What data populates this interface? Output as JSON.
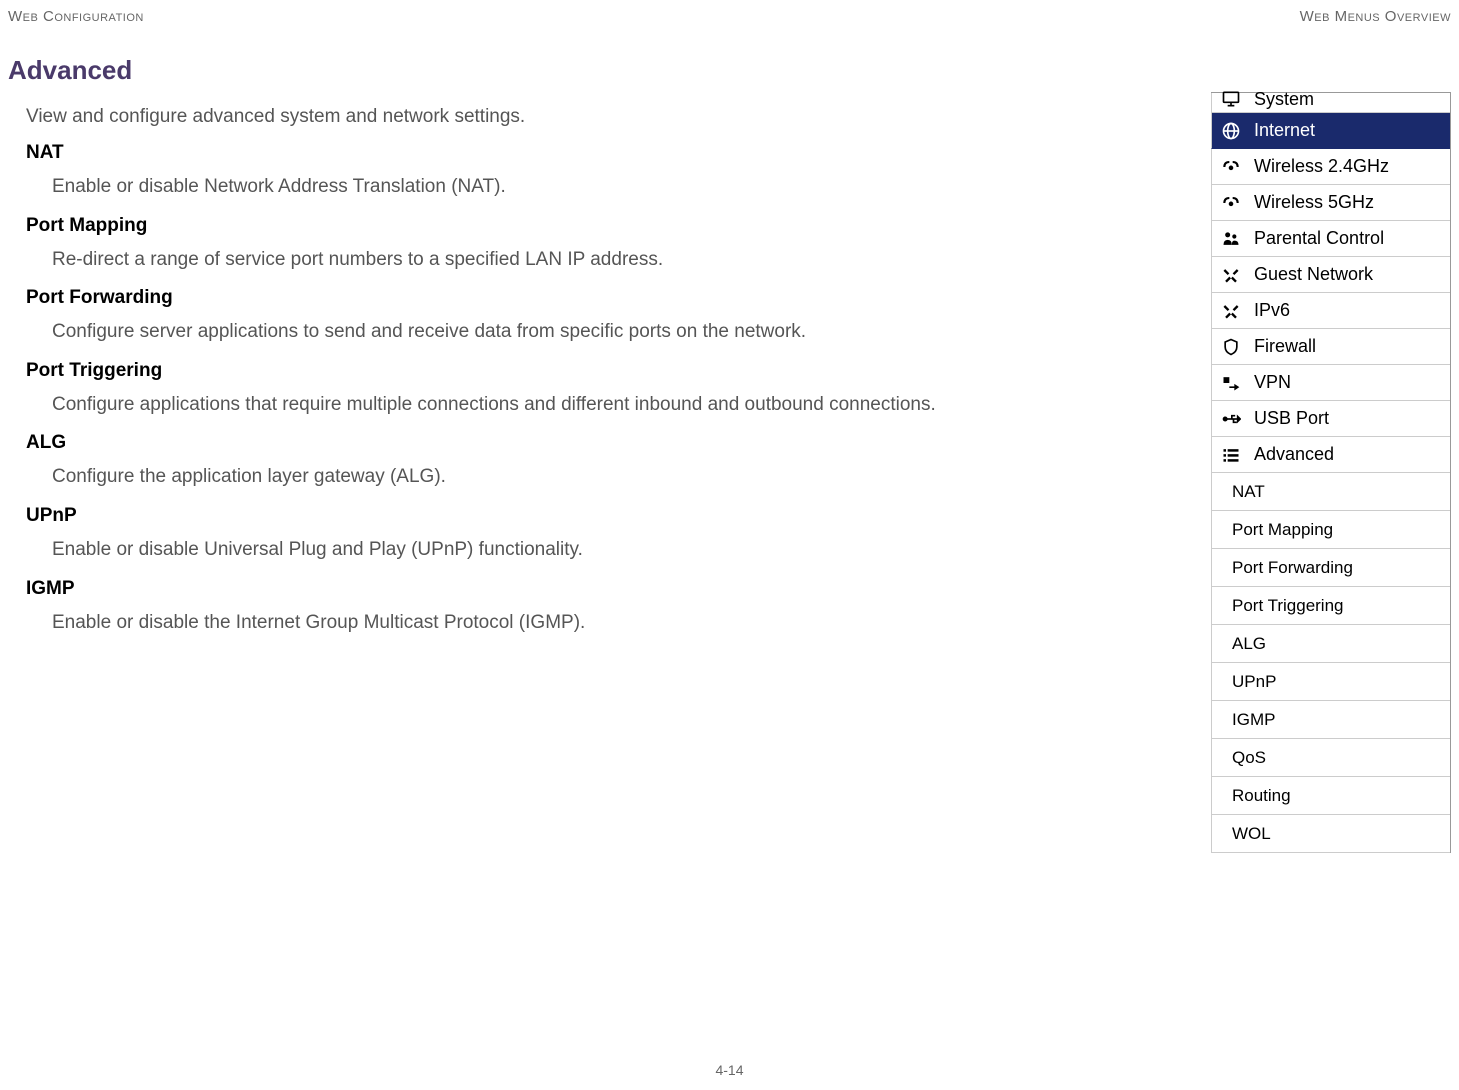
{
  "header": {
    "left": "Web Configuration",
    "right": "Web Menus Overview"
  },
  "section": {
    "title": "Advanced",
    "intro": "View and configure advanced system and network settings.",
    "items": [
      {
        "title": "NAT",
        "desc": "Enable or disable Network Address Translation (NAT)."
      },
      {
        "title": "Port Mapping",
        "desc": "Re-direct a range of service port numbers to a specified LAN IP address."
      },
      {
        "title": "Port Forwarding",
        "desc": "Configure server applications to send and receive data from specific ports on the network."
      },
      {
        "title": "Port Triggering",
        "desc": "Configure applications that require multiple connections and different inbound and outbound connections."
      },
      {
        "title": "ALG",
        "desc": "Configure the application layer gateway (ALG)."
      },
      {
        "title": "UPnP",
        "desc": "Enable or disable Universal Plug and Play (UPnP) functionality."
      },
      {
        "title": "IGMP",
        "desc": "Enable or disable the Internet Group Multicast Protocol (IGMP)."
      }
    ]
  },
  "sidebar": {
    "main": [
      {
        "label": "System",
        "icon": "monitor",
        "active": false,
        "cut": true
      },
      {
        "label": "Internet",
        "icon": "globe",
        "active": true
      },
      {
        "label": "Wireless 2.4GHz",
        "icon": "wifi",
        "active": false
      },
      {
        "label": "Wireless 5GHz",
        "icon": "wifi",
        "active": false
      },
      {
        "label": "Parental Control",
        "icon": "users",
        "active": false
      },
      {
        "label": "Guest Network",
        "icon": "tools",
        "active": false
      },
      {
        "label": "IPv6",
        "icon": "tools",
        "active": false
      },
      {
        "label": "Firewall",
        "icon": "shield",
        "active": false
      },
      {
        "label": "VPN",
        "icon": "arrow",
        "active": false
      },
      {
        "label": "USB Port",
        "icon": "usb",
        "active": false
      },
      {
        "label": "Advanced",
        "icon": "list",
        "active": false
      }
    ],
    "sub": [
      "NAT",
      "Port Mapping",
      "Port Forwarding",
      "Port Triggering",
      "ALG",
      "UPnP",
      "IGMP",
      "QoS",
      "Routing",
      "WOL"
    ]
  },
  "footer": {
    "page": "4-14"
  }
}
